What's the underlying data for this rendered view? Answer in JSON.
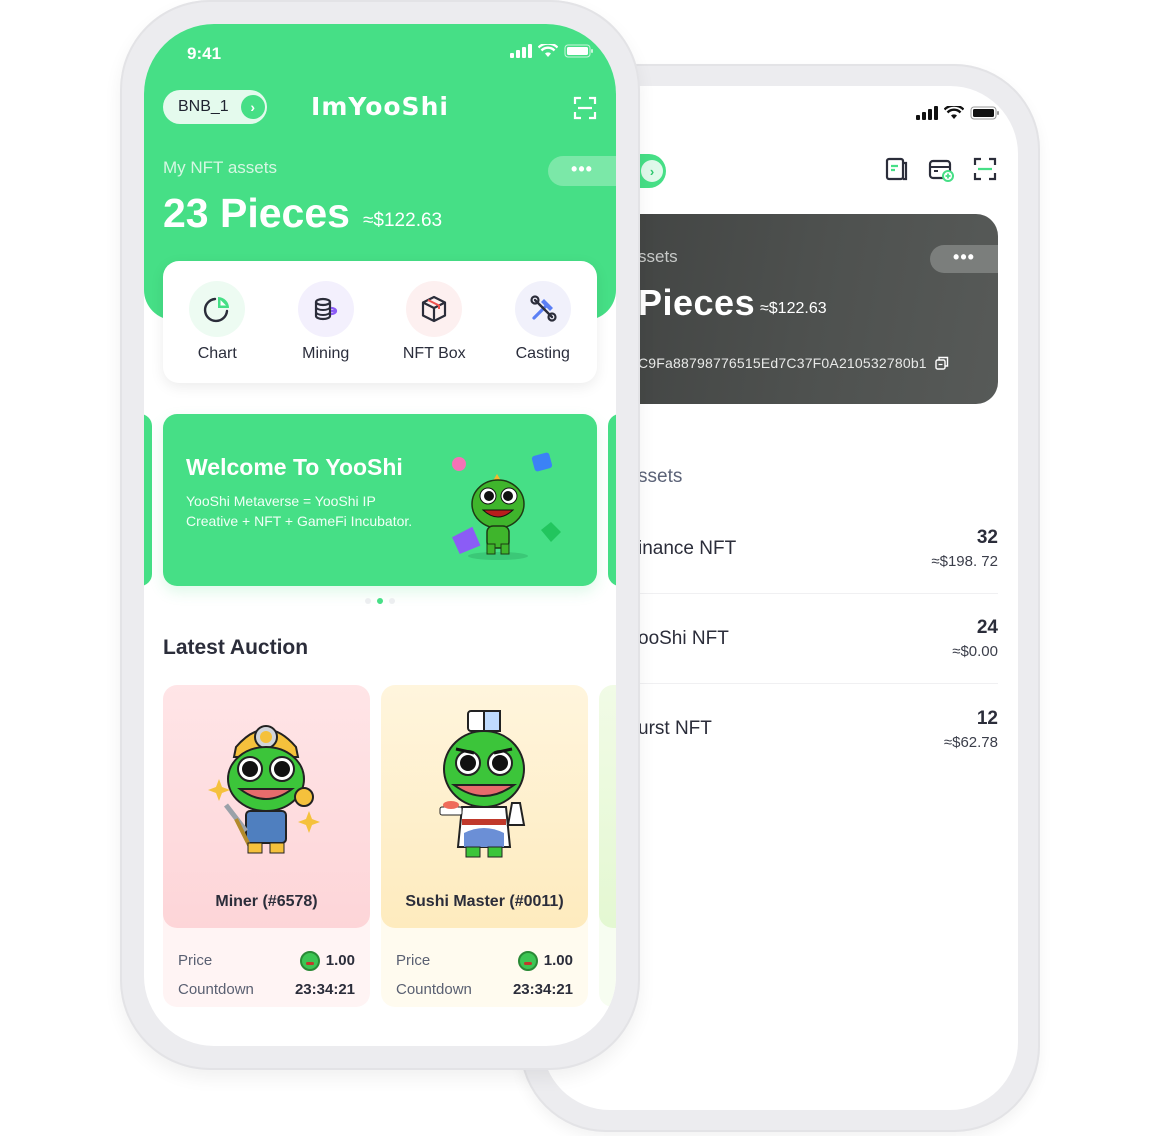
{
  "colors": {
    "brand_green": "#46df86",
    "dark_card": "#4e514f",
    "text_dark": "#2b2d3a",
    "miner_bg": "#fde1e3",
    "sushi_bg": "#fef1d2",
    "peek_bg": "#eefbe1"
  },
  "front": {
    "status": {
      "time": "9:41",
      "icons": [
        "signal-icon",
        "wifi-icon",
        "battery-icon"
      ]
    },
    "header": {
      "wallet_name": "BNB_1",
      "app_title": "ImYooShi",
      "scan_icon": "scan-icon"
    },
    "assets": {
      "label": "My NFT assets",
      "count": "23 Pieces",
      "usd": "≈$122.63",
      "more": "•••"
    },
    "quick_actions": [
      {
        "label": "Chart",
        "icon": "pie-chart-icon"
      },
      {
        "label": "Mining",
        "icon": "coins-icon"
      },
      {
        "label": "NFT Box",
        "icon": "box-icon"
      },
      {
        "label": "Casting",
        "icon": "tools-icon"
      }
    ],
    "banner": {
      "title": "Welcome To YooShi",
      "text": "YooShi Metaverse = YooShi IP Creative + NFT + GameFi Incubator.",
      "active_slide": 2,
      "slide_count": 3
    },
    "auction": {
      "title": "Latest Auction",
      "items": [
        {
          "name": "Miner (#6578)",
          "price_label": "Price",
          "price": "1.00",
          "countdown_label": "Countdown",
          "countdown": "23:34:21"
        },
        {
          "name": "Sushi Master (#0011)",
          "price_label": "Price",
          "price": "1.00",
          "countdown_label": "Countdown",
          "countdown": "23:34:21"
        }
      ]
    }
  },
  "back": {
    "toolbar_icons": [
      "document-icon",
      "wallet-add-icon",
      "scan-icon"
    ],
    "card": {
      "label": "ssets",
      "count": "Pieces",
      "usd": "≈$122.63",
      "address": "C9Fa88798776515Ed7C37F0A210532780b1",
      "more": "•••"
    },
    "section_title": "ssets",
    "assets": [
      {
        "name": "inance NFT",
        "count": "32",
        "value": "≈$198. 72"
      },
      {
        "name": "ooShi NFT",
        "count": "24",
        "value": "≈$0.00"
      },
      {
        "name": "urst NFT",
        "count": "12",
        "value": "≈$62.78"
      }
    ]
  }
}
